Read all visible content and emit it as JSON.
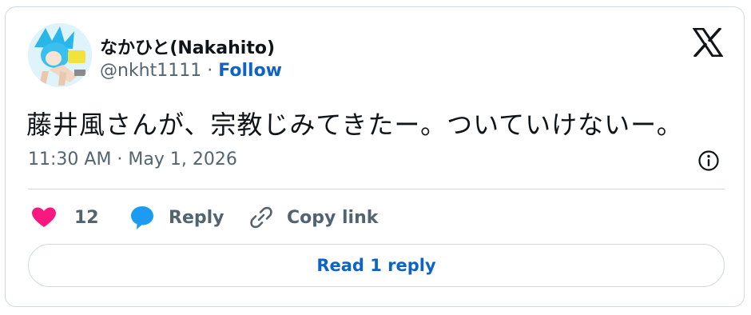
{
  "author": {
    "display_name": "なかひと(Nakahito)",
    "handle": "@nkht1111",
    "separator": " · ",
    "follow_label": "Follow"
  },
  "tweet": {
    "text": "藤井風さんが、宗教じみてきたー。ついていけないー。",
    "timestamp": "11:30 AM · May 1, 2026"
  },
  "actions": {
    "like_count": "12",
    "reply_label": "Reply",
    "copy_link_label": "Copy link"
  },
  "read_replies_label": "Read 1 reply",
  "colors": {
    "follow_blue": "#0e63c7",
    "like_pink": "#f91880",
    "reply_blue": "#1d9bf0",
    "muted_gray": "#536471",
    "border": "#cfd9de"
  },
  "icons": {
    "logo": "x-logo-icon",
    "info": "info-icon",
    "like": "heart-icon",
    "reply": "speech-bubble-icon",
    "copy": "link-icon"
  }
}
